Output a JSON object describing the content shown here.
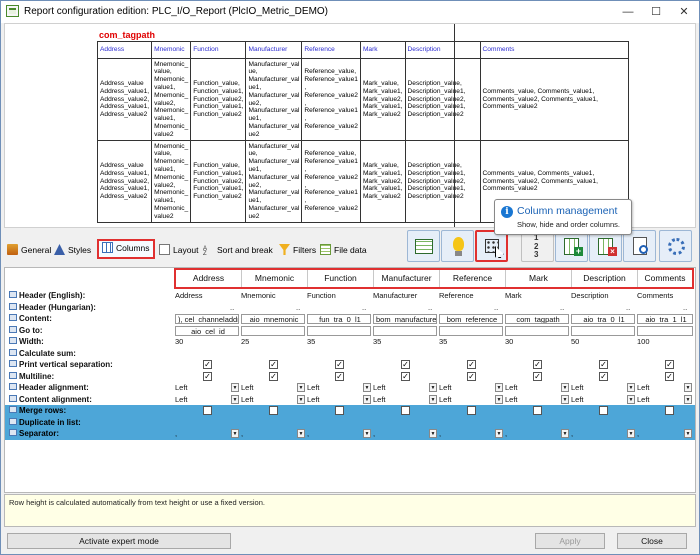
{
  "window": {
    "title": "Report configuration edition: PLC_I/O_Report (PlcIO_Metric_DEMO)",
    "minimize": "—",
    "maximize": "☐",
    "close": "✕"
  },
  "preview": {
    "tagpath": "com_tagpath",
    "headers": [
      "Address",
      "Mnemonic",
      "Function",
      "Manufacturer",
      "Reference",
      "Mark",
      "Description",
      "Comments"
    ],
    "row1": {
      "address": "Address_value\nAddress_value1,\nAddress_value2,\nAddress_value1,\nAddress_value2",
      "mnemonic": "Mnemonic_\nvalue,\nMnemonic_\nvalue1,\nMnemonic_\nvalue2,\nMnemonic_\nvalue1,\nMnemonic_\nvalue2",
      "function": "Function_value,\nFunction_value1,\nFunction_value2,\nFunction_value1,\nFunction_value2",
      "manufacturer": "Manufacturer_val\nue,\nManufacturer_val\nue1,\nManufacturer_val\nue2,\nManufacturer_val\nue1,\nManufacturer_val\nue2",
      "reference": "Reference_value,\nReference_value1\n,\nReference_value2\n,\nReference_value1\n,\nReference_value2",
      "mark": "Mark_value,\nMark_value1,\nMark_value2,\nMark_value1,\nMark_value2",
      "description": "Description_value,\nDescription_value1,\nDescription_value2,\nDescription_value1,\nDescription_value2",
      "comments": "Comments_value, Comments_value1,\nComments_value2, Comments_value1,\nComments_value2"
    },
    "row2": {
      "address": "Address_value\nAddress_value1,\nAddress_value2,\nAddress_value1,\nAddress_value2",
      "mnemonic": "Mnemonic_\nvalue,\nMnemonic_\nvalue1,\nMnemonic_\nvalue2,\nMnemonic_\nvalue1,\nMnemonic_\nvalue2",
      "function": "Function_value,\nFunction_value1,\nFunction_value2,\nFunction_value1,\nFunction_value2",
      "manufacturer": "Manufacturer_val\nue,\nManufacturer_val\nue1,\nManufacturer_val\nue2,\nManufacturer_val\nue1,\nManufacturer_val\nue2",
      "reference": "Reference_value,\nReference_value1\n,\nReference_value2\n,\nReference_value1\n,\nReference_value2",
      "mark": "Mark_value,\nMark_value1,\nMark_value2,\nMark_value1,\nMark_value2",
      "description": "Description_value,\nDescription_value1,\nDescription_value2,\nDescription_value1,\nDescription_value2",
      "comments": "Comments_value, Comments_value1,\nComments_value2, Comments_value1,\nComments_value2"
    }
  },
  "tabs": {
    "general": "General",
    "styles": "Styles",
    "columns": "Columns",
    "layout": "Layout",
    "sort": "Sort and break",
    "filters": "Filters",
    "filedata": "File data"
  },
  "toolbar": {
    "buttons": [
      "table-icon",
      "lightbulb-icon",
      "column-management-icon",
      "numbering-icon",
      "add-column-icon",
      "remove-column-icon",
      "preview-icon",
      "settings-icon"
    ],
    "numbering_label": "1\n2\n3"
  },
  "tooltip": {
    "info": "i",
    "title": "Column management",
    "description": "Show, hide and order columns."
  },
  "grid": {
    "columns": [
      "Address",
      "Mnemonic",
      "Function",
      "Manufacturer",
      "Reference",
      "Mark",
      "Description",
      "Comments"
    ],
    "rows": {
      "header_en": "Header (English):",
      "header_hu": "Header (Hungarian):",
      "content": "Content:",
      "goto": "Go to:",
      "width": "Width:",
      "calc_sum": "Calculate sum:",
      "print_sep": "Print vertical separation:",
      "multiline": "Multiline:",
      "header_align": "Header alignment:",
      "content_align": "Content alignment:",
      "merge": "Merge rows:",
      "duplicate": "Duplicate in list:",
      "separator": "Separator:"
    },
    "header_en_values": [
      "Address",
      "Mnemonic",
      "Function",
      "Manufacturer",
      "Reference",
      "Mark",
      "Description",
      "Comments"
    ],
    "header_hu_values": [
      "..",
      "..",
      "..",
      "..",
      "..",
      "..",
      "..",
      ".."
    ],
    "content_values": [
      "), cel_channeladdre",
      "aio_mnemonic",
      "fun_tra_0_l1",
      "bom_manufacturer",
      "bom_reference",
      "com_tagpath",
      "aio_tra_0_l1",
      "aio_tra_1_l1"
    ],
    "goto_value": "aio_cel_id",
    "width_values": [
      "30",
      "25",
      "35",
      "35",
      "35",
      "30",
      "50",
      "100"
    ],
    "align_values": [
      "Left",
      "Left",
      "Left",
      "Left",
      "Left",
      "Left",
      "Left",
      "Left"
    ],
    "separator_value": ","
  },
  "footer": {
    "note": "Row height is calculated automatically from text height or use a fixed version.",
    "expert": "Activate expert mode",
    "apply": "Apply",
    "close": "Close"
  },
  "colors": {
    "highlight": "#e03030",
    "blue_row": "#4da6d8",
    "tag_red": "#e00000",
    "header_blue": "#2a2ad0"
  }
}
